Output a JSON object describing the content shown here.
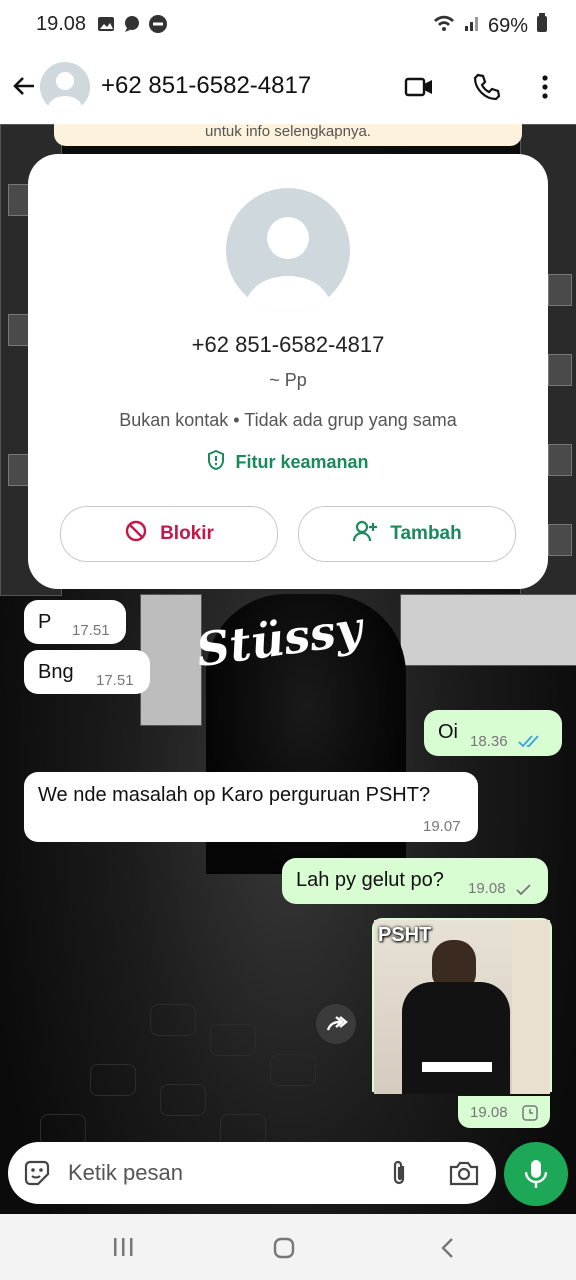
{
  "status": {
    "time": "19.08",
    "battery": "69%"
  },
  "header": {
    "title": "+62 851-6582-4817"
  },
  "banner": {
    "text": "untuk info selengkapnya."
  },
  "card": {
    "number": "+62 851-6582-4817",
    "name": "~ Pp",
    "info": "Bukan kontak • Tidak ada grup yang sama",
    "security": "Fitur keamanan",
    "block_label": "Blokir",
    "add_label": "Tambah",
    "colors": {
      "block": "#c4174a",
      "add": "#1a8a5c"
    }
  },
  "wallpaper": {
    "logo_text": "Stüssy"
  },
  "messages": [
    {
      "dir": "in",
      "text": "P",
      "time": "17.51"
    },
    {
      "dir": "in",
      "text": "Bng",
      "time": "17.51"
    },
    {
      "dir": "out",
      "text": "Oi",
      "time": "18.36",
      "status": "read"
    },
    {
      "dir": "in",
      "text": "We nde masalah op Karo perguruan PSHT?",
      "time": "19.07"
    },
    {
      "dir": "out",
      "text": "Lah py gelut po?",
      "time": "19.08",
      "status": "sent"
    },
    {
      "dir": "out",
      "type": "image",
      "caption": "PSHT",
      "time": "19.08",
      "status": "pending"
    }
  ],
  "input": {
    "placeholder": "Ketik pesan"
  },
  "icons": [
    "back-arrow-icon",
    "video-call-icon",
    "phone-icon",
    "more-icon",
    "shield-icon",
    "block-icon",
    "add-contact-icon",
    "forward-icon",
    "sticker-icon",
    "attach-icon",
    "camera-icon",
    "mic-icon"
  ]
}
